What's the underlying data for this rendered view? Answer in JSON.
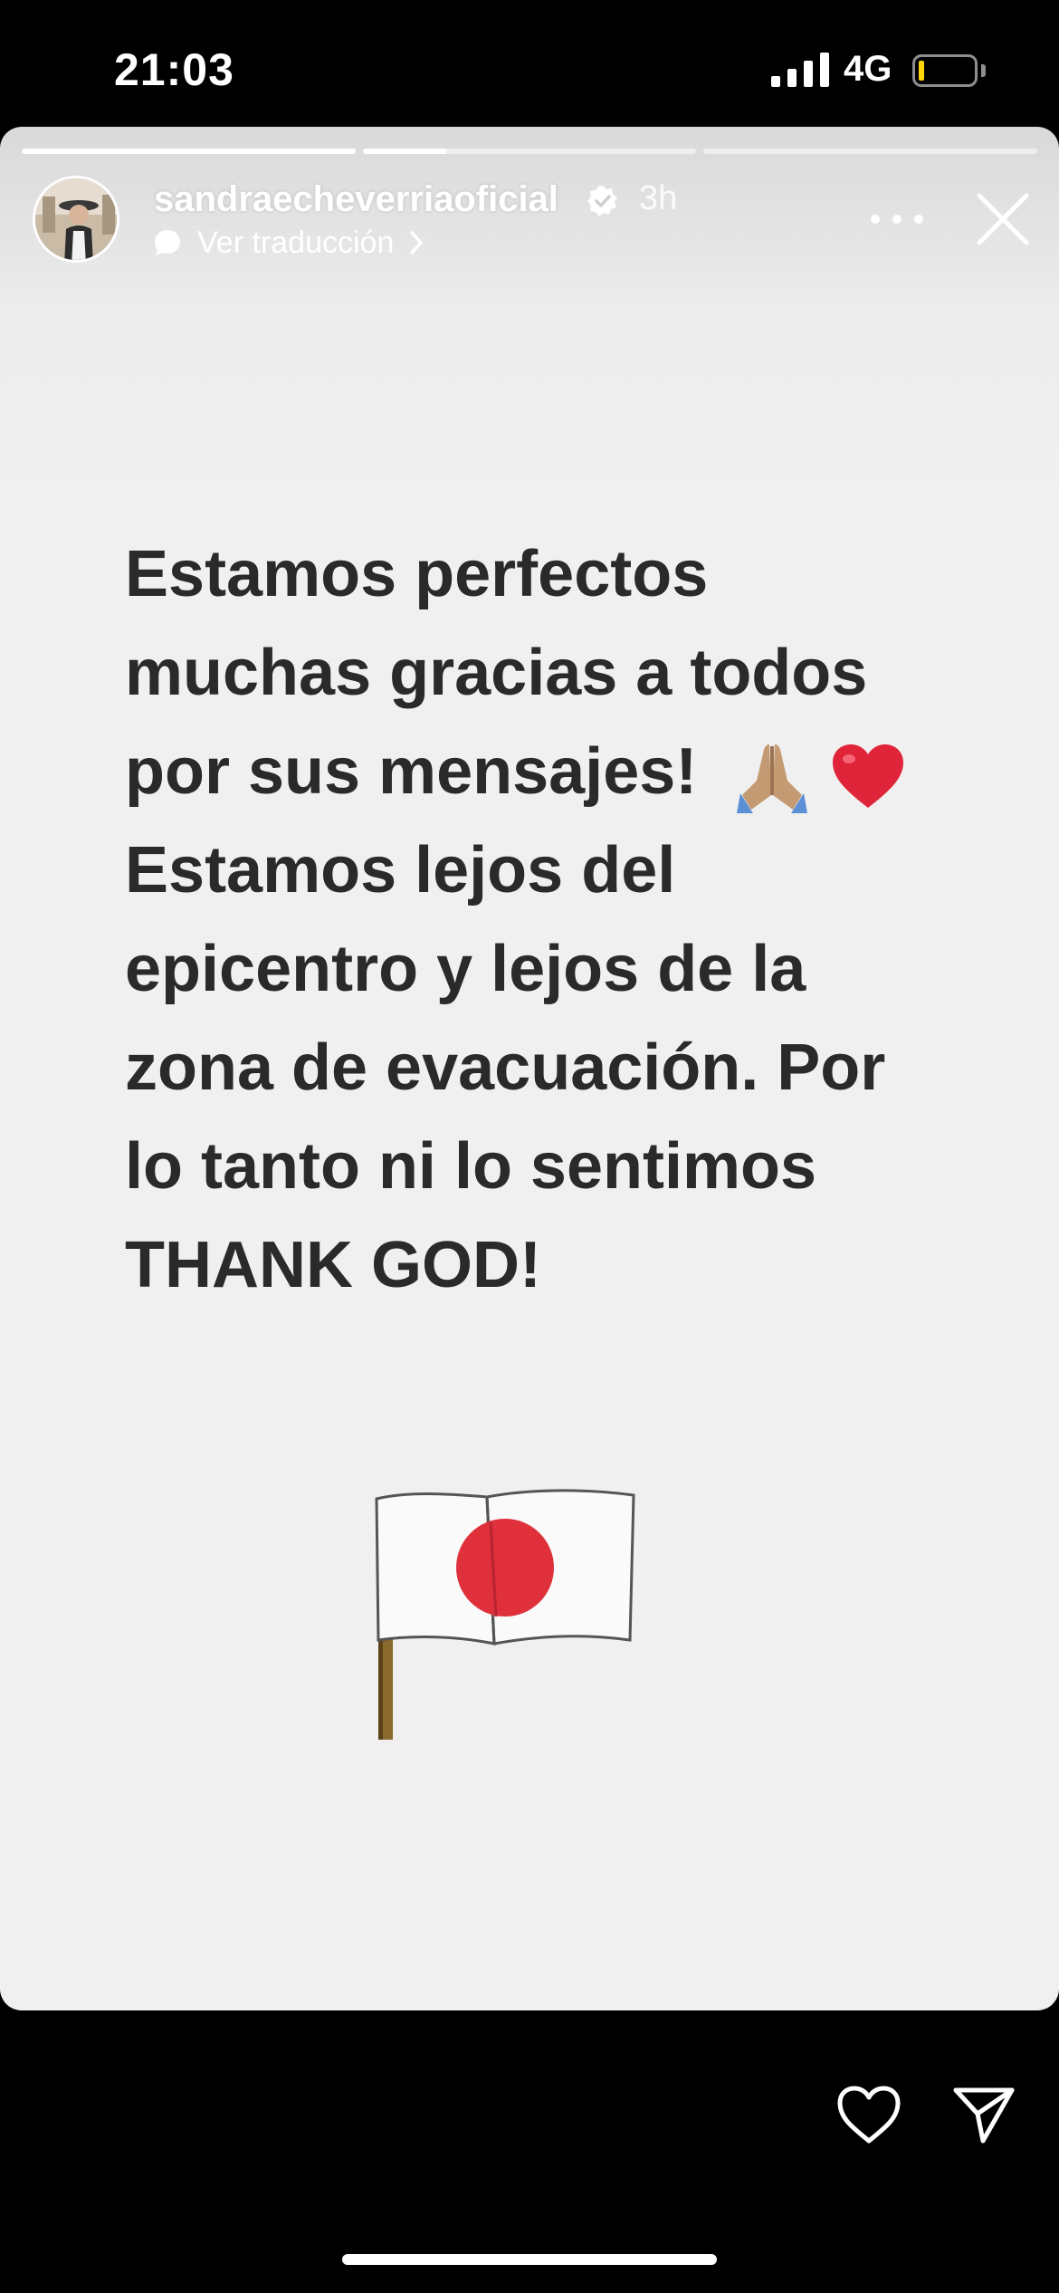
{
  "status_bar": {
    "time": "21:03",
    "network": "4G",
    "battery_level": 0.1
  },
  "story": {
    "progress_segments": [
      1.0,
      0.25,
      0.0
    ],
    "username": "sandraecheverriaoficial",
    "verified": true,
    "time_ago": "3h",
    "translate_label": "Ver traducción",
    "lines": [
      "Estamos perfectos",
      "muchas gracias a todos",
      "por sus mensajes!",
      "Estamos lejos del",
      "epicentro y lejos de la",
      "zona de evacuación. Por",
      "lo tanto ni lo sentimos",
      "THANK GOD!"
    ],
    "inline_emojis": [
      "folded-hands",
      "red-heart"
    ],
    "sticker": "japan-flag",
    "colors": {
      "text": "#2a2a2a",
      "background": "#f0f0f0",
      "flag_red": "#e0303c"
    }
  },
  "bottom_bar": {
    "icons": [
      "heart-icon",
      "send-icon"
    ]
  }
}
